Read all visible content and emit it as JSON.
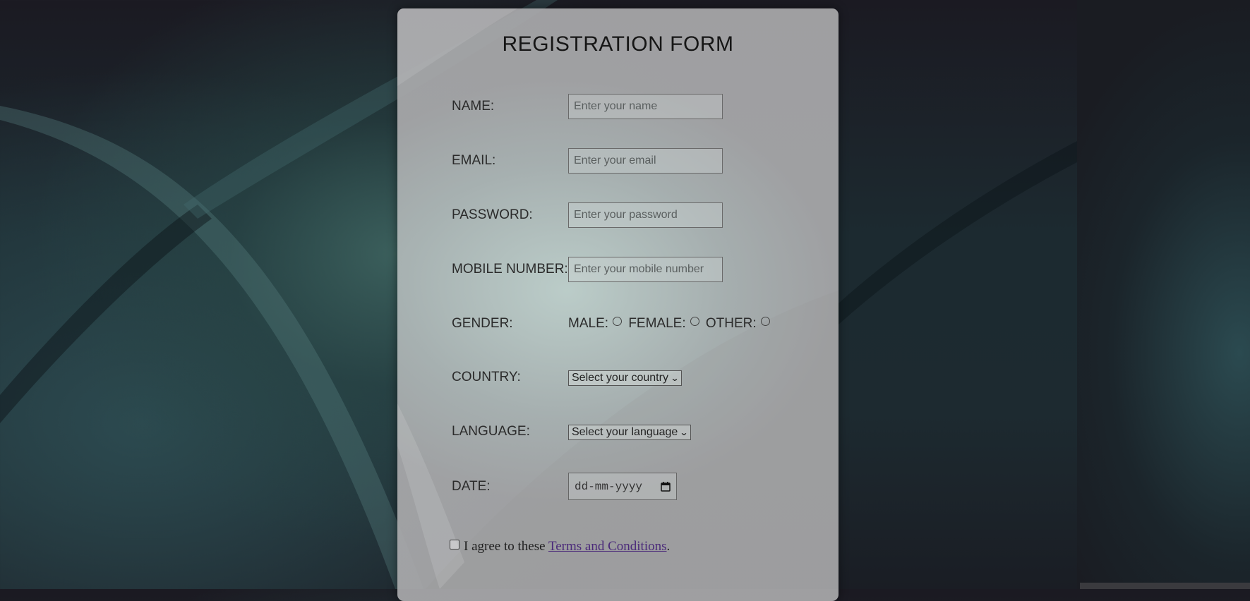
{
  "form": {
    "title": "REGISTRATION FORM",
    "name": {
      "label": "NAME:",
      "placeholder": "Enter your name"
    },
    "email": {
      "label": "EMAIL:",
      "placeholder": "Enter your email"
    },
    "password": {
      "label": "PASSWORD:",
      "placeholder": "Enter your password"
    },
    "mobile": {
      "label": "MOBILE NUMBER:",
      "placeholder": "Enter your mobile number"
    },
    "gender": {
      "label": "GENDER:",
      "options": [
        "MALE:",
        "FEMALE:",
        "OTHER:"
      ]
    },
    "country": {
      "label": "COUNTRY:",
      "selected": "Select your country"
    },
    "language": {
      "label": "LANGUAGE:",
      "selected": "Select your language"
    },
    "date": {
      "label": "DATE:",
      "placeholder": "dd-mm-yyyy"
    },
    "terms": {
      "prefix": "I agree to these",
      "link_text": "Terms and Conditions",
      "suffix": "."
    }
  },
  "icons": {
    "calendar": "calendar-icon",
    "dropdown": "chevron-down-icon"
  },
  "colors": {
    "link": "#4b2a7a",
    "title": "#161616"
  }
}
